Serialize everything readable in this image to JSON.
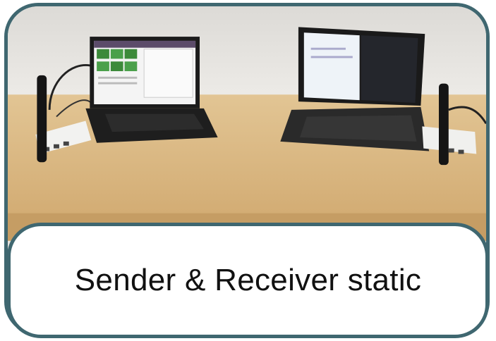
{
  "caption": {
    "text": "Sender & Receiver static"
  },
  "photo": {
    "scene_objects": [
      "wall",
      "wooden-table",
      "laptop",
      "laptop",
      "router",
      "router",
      "antenna",
      "antenna"
    ]
  },
  "colors": {
    "border": "#3f6770",
    "wall": "#e6e3df",
    "table": "#d8b57f"
  }
}
